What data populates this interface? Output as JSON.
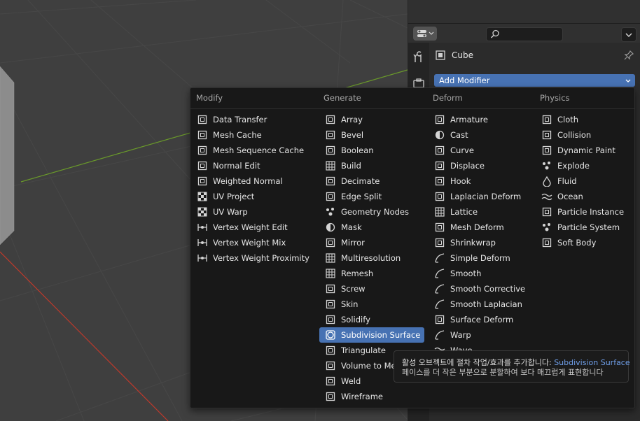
{
  "object": {
    "name": "Cube"
  },
  "add_modifier": {
    "label": "Add Modifier"
  },
  "menu": {
    "columns": [
      {
        "title": "Modify",
        "items": [
          {
            "label": "Data Transfer",
            "icon": "data-transfer-icon"
          },
          {
            "label": "Mesh Cache",
            "icon": "mesh-cache-icon"
          },
          {
            "label": "Mesh Sequence Cache",
            "icon": "mesh-sequence-cache-icon"
          },
          {
            "label": "Normal Edit",
            "icon": "normal-edit-icon"
          },
          {
            "label": "Weighted Normal",
            "icon": "weighted-normal-icon"
          },
          {
            "label": "UV Project",
            "icon": "uv-project-icon"
          },
          {
            "label": "UV Warp",
            "icon": "uv-warp-icon"
          },
          {
            "label": "Vertex Weight Edit",
            "icon": "vertex-weight-icon"
          },
          {
            "label": "Vertex Weight Mix",
            "icon": "vertex-weight-icon"
          },
          {
            "label": "Vertex Weight Proximity",
            "icon": "vertex-weight-icon"
          }
        ]
      },
      {
        "title": "Generate",
        "items": [
          {
            "label": "Array",
            "icon": "array-icon"
          },
          {
            "label": "Bevel",
            "icon": "bevel-icon"
          },
          {
            "label": "Boolean",
            "icon": "boolean-icon"
          },
          {
            "label": "Build",
            "icon": "build-icon"
          },
          {
            "label": "Decimate",
            "icon": "decimate-icon"
          },
          {
            "label": "Edge Split",
            "icon": "edge-split-icon"
          },
          {
            "label": "Geometry Nodes",
            "icon": "geometry-nodes-icon"
          },
          {
            "label": "Mask",
            "icon": "mask-icon"
          },
          {
            "label": "Mirror",
            "icon": "mirror-icon"
          },
          {
            "label": "Multiresolution",
            "icon": "multiresolution-icon"
          },
          {
            "label": "Remesh",
            "icon": "remesh-icon"
          },
          {
            "label": "Screw",
            "icon": "screw-icon"
          },
          {
            "label": "Skin",
            "icon": "skin-icon"
          },
          {
            "label": "Solidify",
            "icon": "solidify-icon"
          },
          {
            "label": "Subdivision Surface",
            "icon": "subdivision-surface-icon",
            "active": true
          },
          {
            "label": "Triangulate",
            "icon": "triangulate-icon"
          },
          {
            "label": "Volume to Mesh",
            "icon": "volume-to-mesh-icon"
          },
          {
            "label": "Weld",
            "icon": "weld-icon"
          },
          {
            "label": "Wireframe",
            "icon": "wireframe-icon"
          }
        ]
      },
      {
        "title": "Deform",
        "items": [
          {
            "label": "Armature",
            "icon": "armature-icon"
          },
          {
            "label": "Cast",
            "icon": "cast-icon"
          },
          {
            "label": "Curve",
            "icon": "curve-icon"
          },
          {
            "label": "Displace",
            "icon": "displace-icon"
          },
          {
            "label": "Hook",
            "icon": "hook-icon"
          },
          {
            "label": "Laplacian Deform",
            "icon": "laplacian-deform-icon"
          },
          {
            "label": "Lattice",
            "icon": "lattice-icon"
          },
          {
            "label": "Mesh Deform",
            "icon": "mesh-deform-icon"
          },
          {
            "label": "Shrinkwrap",
            "icon": "shrinkwrap-icon"
          },
          {
            "label": "Simple Deform",
            "icon": "simple-deform-icon"
          },
          {
            "label": "Smooth",
            "icon": "smooth-icon"
          },
          {
            "label": "Smooth Corrective",
            "icon": "smooth-icon"
          },
          {
            "label": "Smooth Laplacian",
            "icon": "smooth-icon"
          },
          {
            "label": "Surface Deform",
            "icon": "surface-deform-icon"
          },
          {
            "label": "Warp",
            "icon": "warp-icon"
          },
          {
            "label": "Wave",
            "icon": "wave-icon"
          }
        ]
      },
      {
        "title": "Physics",
        "items": [
          {
            "label": "Cloth",
            "icon": "cloth-icon"
          },
          {
            "label": "Collision",
            "icon": "collision-icon"
          },
          {
            "label": "Dynamic Paint",
            "icon": "dynamic-paint-icon"
          },
          {
            "label": "Explode",
            "icon": "explode-icon"
          },
          {
            "label": "Fluid",
            "icon": "fluid-icon"
          },
          {
            "label": "Ocean",
            "icon": "ocean-icon"
          },
          {
            "label": "Particle Instance",
            "icon": "particle-instance-icon"
          },
          {
            "label": "Particle System",
            "icon": "particle-system-icon"
          },
          {
            "label": "Soft Body",
            "icon": "soft-body-icon"
          }
        ]
      }
    ]
  },
  "tooltip": {
    "line1_prefix": "활성 오브젝트에 절차 작업/효과를 추가합니다:",
    "line1_highlight": "Subdivision Surface",
    "line2": "페이스를 더 작은 부분으로 분할하여 보다 매끄럽게 표현합니다"
  },
  "colors": {
    "accent": "#4772b3",
    "menu_bg": "#181818",
    "x_axis": "#c0392b",
    "y_axis": "#6a9a2a"
  }
}
